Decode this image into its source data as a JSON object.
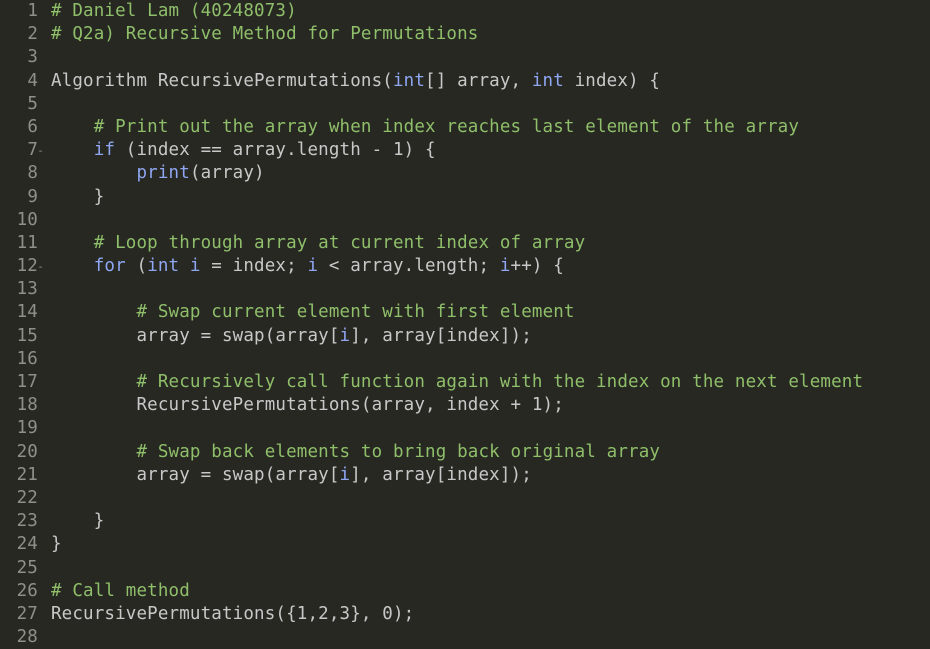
{
  "editor": {
    "lines": [
      {
        "n": "1",
        "fold": false,
        "tokens": [
          {
            "c": "cm",
            "t": "# Daniel Lam (40248073)"
          }
        ]
      },
      {
        "n": "2",
        "fold": false,
        "tokens": [
          {
            "c": "cm",
            "t": "# Q2a) Recursive Method for Permutations"
          }
        ]
      },
      {
        "n": "3",
        "fold": false,
        "tokens": []
      },
      {
        "n": "4",
        "fold": false,
        "tokens": [
          {
            "c": "pl",
            "t": "Algorithm RecursivePermutations("
          },
          {
            "c": "kw",
            "t": "int"
          },
          {
            "c": "pl",
            "t": "[] array, "
          },
          {
            "c": "kw",
            "t": "int"
          },
          {
            "c": "pl",
            "t": " index) {"
          }
        ]
      },
      {
        "n": "5",
        "fold": false,
        "tokens": []
      },
      {
        "n": "6",
        "fold": false,
        "tokens": [
          {
            "c": "pl",
            "t": "    "
          },
          {
            "c": "cm",
            "t": "# Print out the array when index reaches last element of the array"
          }
        ]
      },
      {
        "n": "7",
        "fold": true,
        "tokens": [
          {
            "c": "pl",
            "t": "    "
          },
          {
            "c": "kw",
            "t": "if"
          },
          {
            "c": "pl",
            "t": " (index == array.length - 1) {"
          }
        ]
      },
      {
        "n": "8",
        "fold": false,
        "tokens": [
          {
            "c": "pl",
            "t": "        "
          },
          {
            "c": "kw",
            "t": "print"
          },
          {
            "c": "pl",
            "t": "(array)"
          }
        ]
      },
      {
        "n": "9",
        "fold": false,
        "tokens": [
          {
            "c": "pl",
            "t": "    }"
          }
        ]
      },
      {
        "n": "10",
        "fold": false,
        "tokens": []
      },
      {
        "n": "11",
        "fold": false,
        "tokens": [
          {
            "c": "pl",
            "t": "    "
          },
          {
            "c": "cm",
            "t": "# Loop through array at current index of array"
          }
        ]
      },
      {
        "n": "12",
        "fold": true,
        "tokens": [
          {
            "c": "pl",
            "t": "    "
          },
          {
            "c": "kw",
            "t": "for"
          },
          {
            "c": "pl",
            "t": " ("
          },
          {
            "c": "kw",
            "t": "int i"
          },
          {
            "c": "pl",
            "t": " = index; "
          },
          {
            "c": "kw",
            "t": "i"
          },
          {
            "c": "pl",
            "t": " < array.length; "
          },
          {
            "c": "kw",
            "t": "i"
          },
          {
            "c": "pl",
            "t": "++) {"
          }
        ]
      },
      {
        "n": "13",
        "fold": false,
        "tokens": []
      },
      {
        "n": "14",
        "fold": false,
        "tokens": [
          {
            "c": "pl",
            "t": "        "
          },
          {
            "c": "cm",
            "t": "# Swap current element with first element"
          }
        ]
      },
      {
        "n": "15",
        "fold": false,
        "tokens": [
          {
            "c": "pl",
            "t": "        array = swap(array["
          },
          {
            "c": "kw",
            "t": "i"
          },
          {
            "c": "pl",
            "t": "], array[index]);"
          }
        ]
      },
      {
        "n": "16",
        "fold": false,
        "tokens": []
      },
      {
        "n": "17",
        "fold": false,
        "tokens": [
          {
            "c": "pl",
            "t": "        "
          },
          {
            "c": "cm",
            "t": "# Recursively call function again with the index on the next element"
          }
        ]
      },
      {
        "n": "18",
        "fold": false,
        "tokens": [
          {
            "c": "pl",
            "t": "        RecursivePermutations(array, index + 1);"
          }
        ]
      },
      {
        "n": "19",
        "fold": false,
        "tokens": []
      },
      {
        "n": "20",
        "fold": false,
        "tokens": [
          {
            "c": "pl",
            "t": "        "
          },
          {
            "c": "cm",
            "t": "# Swap back elements to bring back original array"
          }
        ]
      },
      {
        "n": "21",
        "fold": false,
        "tokens": [
          {
            "c": "pl",
            "t": "        array = swap(array["
          },
          {
            "c": "kw",
            "t": "i"
          },
          {
            "c": "pl",
            "t": "], array[index]);"
          }
        ]
      },
      {
        "n": "22",
        "fold": false,
        "tokens": []
      },
      {
        "n": "23",
        "fold": false,
        "tokens": [
          {
            "c": "pl",
            "t": "    }"
          }
        ]
      },
      {
        "n": "24",
        "fold": false,
        "tokens": [
          {
            "c": "pl",
            "t": "}"
          }
        ]
      },
      {
        "n": "25",
        "fold": false,
        "tokens": []
      },
      {
        "n": "26",
        "fold": false,
        "tokens": [
          {
            "c": "cm",
            "t": "# Call method"
          }
        ]
      },
      {
        "n": "27",
        "fold": false,
        "tokens": [
          {
            "c": "pl",
            "t": "RecursivePermutations({1,2,3}, 0);"
          }
        ]
      },
      {
        "n": "28",
        "fold": false,
        "tokens": []
      }
    ],
    "fold_glyph": "-"
  },
  "colors": {
    "background": "#272822",
    "gutter_text": "#8f908a",
    "comment": "#8fbf6a",
    "keyword": "#8fa6f2",
    "plain": "#c8c8c8"
  }
}
